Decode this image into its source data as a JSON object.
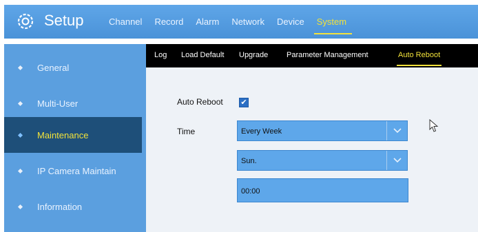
{
  "header": {
    "title": "Setup",
    "tabs": [
      {
        "label": "Channel"
      },
      {
        "label": "Record"
      },
      {
        "label": "Alarm"
      },
      {
        "label": "Network"
      },
      {
        "label": "Device"
      },
      {
        "label": "System",
        "active": true
      }
    ]
  },
  "sidebar": {
    "items": [
      {
        "label": "General"
      },
      {
        "label": "Multi-User"
      },
      {
        "label": "Maintenance",
        "active": true
      },
      {
        "label": "IP Camera Maintain"
      },
      {
        "label": "Information"
      }
    ]
  },
  "subnav": {
    "tabs": [
      {
        "label": "Log"
      },
      {
        "label": "Load Default"
      },
      {
        "label": "Upgrade"
      },
      {
        "label": "Parameter Management"
      },
      {
        "label": "Auto Reboot",
        "active": true
      }
    ]
  },
  "form": {
    "auto_reboot_label": "Auto Reboot",
    "auto_reboot_checked": true,
    "time_label": "Time",
    "frequency_value": "Every Week",
    "day_value": "Sun.",
    "time_value": "00:00"
  },
  "colors": {
    "header_blue": "#5fa6e8",
    "sidebar_blue": "#5b9fdf",
    "active_dark": "#1e4f79",
    "highlight_yellow": "#f2e23a",
    "field_blue": "#5ea7ea"
  },
  "icons": {
    "app": "gear-icon",
    "dropdown": "chevron-down-icon",
    "check": "checkmark-icon",
    "pointer": "mouse-pointer-icon"
  }
}
